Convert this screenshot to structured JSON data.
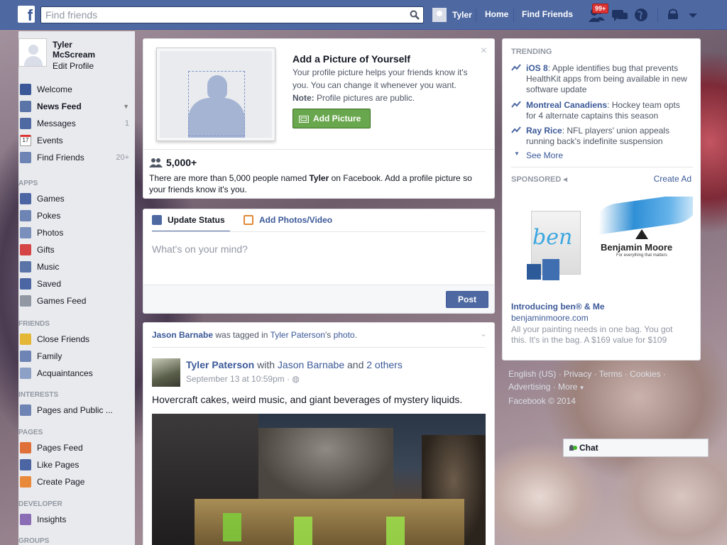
{
  "topbar": {
    "search_placeholder": "Find friends",
    "user_name": "Tyler",
    "home": "Home",
    "find_friends": "Find Friends",
    "friend_requests_badge": "99+"
  },
  "sidebar": {
    "profile": {
      "name": "Tyler McScream",
      "edit": "Edit Profile"
    },
    "favorites": [
      {
        "label": "Welcome",
        "count": "",
        "color": "#3b5998"
      },
      {
        "label": "News Feed",
        "count": "",
        "color": "#5b74a8"
      },
      {
        "label": "Messages",
        "count": "1",
        "color": "#4f6aa3"
      },
      {
        "label": "Events",
        "count": "",
        "color": "#d6d6d6"
      },
      {
        "label": "Find Friends",
        "count": "20+",
        "color": "#6d84b4"
      }
    ],
    "apps_head": "APPS",
    "apps": [
      {
        "label": "Games",
        "color": "#4c66a4"
      },
      {
        "label": "Pokes",
        "color": "#6d84b4"
      },
      {
        "label": "Photos",
        "color": "#7b8fbd"
      },
      {
        "label": "Gifts",
        "color": "#d64545"
      },
      {
        "label": "Music",
        "color": "#5b74a8"
      },
      {
        "label": "Saved",
        "color": "#4c66a4"
      },
      {
        "label": "Games Feed",
        "color": "#9197a3"
      }
    ],
    "friends_head": "FRIENDS",
    "friends": [
      {
        "label": "Close Friends",
        "color": "#e5b737"
      },
      {
        "label": "Family",
        "color": "#6d84b4"
      },
      {
        "label": "Acquaintances",
        "color": "#8da0c6"
      }
    ],
    "interests_head": "INTERESTS",
    "interests": [
      {
        "label": "Pages and Public ...",
        "color": "#6d84b4"
      }
    ],
    "pages_head": "PAGES",
    "pages": [
      {
        "label": "Pages Feed",
        "color": "#e0703a"
      },
      {
        "label": "Like Pages",
        "color": "#4c66a4"
      },
      {
        "label": "Create Page",
        "color": "#e98a3a"
      }
    ],
    "developer_head": "DEVELOPER",
    "developer": [
      {
        "label": "Insights",
        "color": "#8a6db5"
      }
    ],
    "groups_head": "GROUPS"
  },
  "profile_prompt": {
    "title": "Add a Picture of Yourself",
    "text": "Your profile picture helps your friends know it's you. You can change it whenever you want.",
    "note_label": "Note:",
    "note_text": " Profile pictures are public.",
    "button": "Add Picture",
    "count": "5,000+",
    "friends_text_1": "There are more than 5,000 people named ",
    "friends_text_name": "Tyler",
    "friends_text_2": " on Facebook. Add a profile picture so your friends know it's you."
  },
  "composer": {
    "tab_status": "Update Status",
    "tab_photos": "Add Photos/Video",
    "placeholder": "What's on your mind?",
    "post": "Post"
  },
  "story": {
    "context_actor": "Jason Barnabe",
    "context_mid": " was tagged in ",
    "context_owner": "Tyler Paterson",
    "context_poss": "'s ",
    "context_obj": "photo",
    "context_end": ".",
    "author": "Tyler Paterson",
    "with": " with ",
    "with_name": "Jason Barnabe",
    "and": " and ",
    "others": "2 others",
    "time": "September 13 at 10:59pm · ",
    "text": "Hovercraft cakes, weird music, and giant beverages of mystery liquids."
  },
  "trending": {
    "head": "TRENDING",
    "items": [
      {
        "topic": "iOS 8",
        "text": ": Apple identifies bug that prevents HealthKit apps from being available in new software update"
      },
      {
        "topic": "Montreal Canadiens",
        "text": ": Hockey team opts for 4 alternate captains this season"
      },
      {
        "topic": "Ray Rice",
        "text": ": NFL players' union appeals running back's indefinite suspension"
      }
    ],
    "see_more": "See More"
  },
  "sponsored": {
    "head": "SPONSORED",
    "create_ad": "Create Ad",
    "brand": "Benjamin Moore",
    "brand_tagline": "For everything that matters",
    "ben": "ben",
    "title": "Introducing ben® & Me",
    "url": "benjaminmoore.com",
    "text": "All your painting needs in one bag. You got this. It's in the bag. A $169 value for $109"
  },
  "footer": {
    "line1": "English (US) · Privacy · Terms · Cookies ·",
    "line2": "Advertising · More",
    "line3": "Facebook © 2014"
  },
  "chat": {
    "label": "Chat"
  }
}
